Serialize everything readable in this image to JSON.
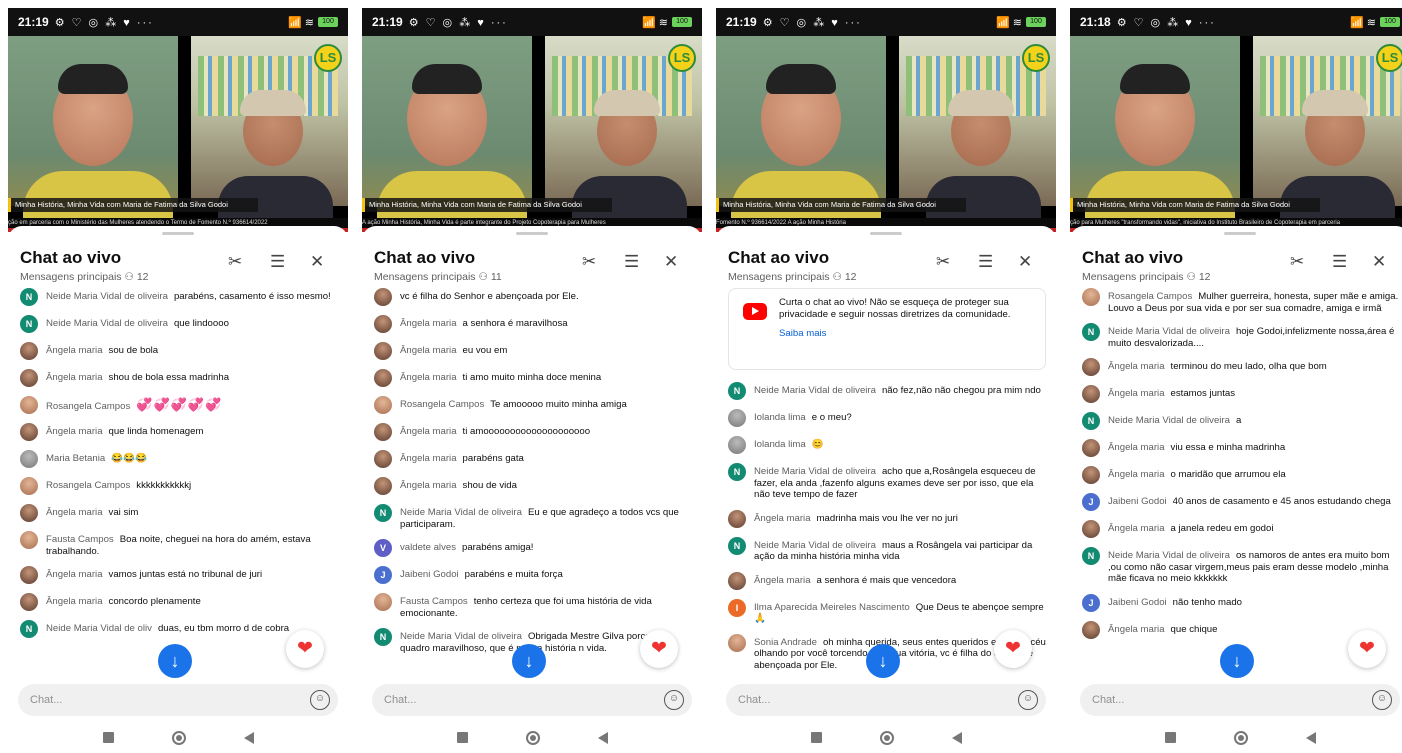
{
  "common": {
    "chat_title": "Chat ao vivo",
    "lower_third": "Minha História, Minha Vida com Maria de Fatima da Silva Godoi",
    "logo_text": "LS",
    "input_placeholder": "Chat...",
    "icons": [
      "scissors-icon",
      "sliders-icon",
      "close-icon",
      "arrow-down-icon",
      "heart-icon",
      "emoji-icon",
      "nav-home-square-icon",
      "nav-circle-icon",
      "nav-back-icon"
    ],
    "colors": {
      "accent": "#1a73e8",
      "heart": "#ee3333",
      "lower_third_bar": "#f2c20f",
      "avatar_n": "#138a72"
    }
  },
  "phones": [
    {
      "time": "21:19",
      "status_icons": "⚙ ♡ ◎ ⁂ ♥ ···",
      "status_right": "📶 ≋",
      "battery": "100",
      "subtitle": "Mensagens principais",
      "viewers": "12",
      "ticker": "ção em parceria com o Ministério das Mulheres atendendo o Termo de Fomento N.º 936614/2022",
      "messages": [
        {
          "av": "n",
          "letter": "N",
          "author": "Neide Maria Vidal de oliveira",
          "text": "parabéns, casamento é isso mesmo!"
        },
        {
          "av": "n",
          "letter": "N",
          "author": "Neide Maria Vidal de oliveira",
          "text": "que lindoooo"
        },
        {
          "av": "p",
          "letter": "",
          "author": "Ângela maria",
          "text": "sou de bola"
        },
        {
          "av": "p",
          "letter": "",
          "author": "Ângela maria",
          "text": "shou de bola essa madrinha"
        },
        {
          "av": "r",
          "letter": "",
          "author": "Rosangela Campos",
          "text": "💞💞💞💞💞"
        },
        {
          "av": "p",
          "letter": "",
          "author": "Ângela maria",
          "text": "que linda homenagem"
        },
        {
          "av": "g",
          "letter": "",
          "author": "Maria Betania",
          "text": "😂😂😂"
        },
        {
          "av": "r",
          "letter": "",
          "author": "Rosangela Campos",
          "text": "kkkkkkkkkkkj"
        },
        {
          "av": "p",
          "letter": "",
          "author": "Ângela maria",
          "text": "vai sim"
        },
        {
          "av": "r",
          "letter": "",
          "author": "Fausta Campos",
          "text": "Boa noite, cheguei na hora do amém, estava trabalhando."
        },
        {
          "av": "p",
          "letter": "",
          "author": "Ângela maria",
          "text": "vamos juntas está no tribunal de juri"
        },
        {
          "av": "p",
          "letter": "",
          "author": "Ângela maria",
          "text": "concordo plenamente"
        },
        {
          "av": "n",
          "letter": "N",
          "author": "Neide Maria Vidal de oliv",
          "text": "duas, eu tbm morro d de cobra"
        }
      ]
    },
    {
      "time": "21:19",
      "status_icons": "⚙ ♡ ◎ ⁂ ♥ ···",
      "status_right": "📶 ≋",
      "battery": "100",
      "subtitle": "Mensagens principais",
      "viewers": "11",
      "ticker": "A ação Minha História, Minha Vida é parte integrante do Projeto Copoterapia para Mulheres",
      "messages": [
        {
          "av": "p",
          "letter": "",
          "author": "",
          "text": "vc é filha do Senhor e abençoada por Ele."
        },
        {
          "av": "p",
          "letter": "",
          "author": "Ângela maria",
          "text": "a senhora é maravilhosa"
        },
        {
          "av": "p",
          "letter": "",
          "author": "Ângela maria",
          "text": "eu vou em"
        },
        {
          "av": "p",
          "letter": "",
          "author": "Ângela maria",
          "text": "ti amo muito minha doce menina"
        },
        {
          "av": "r",
          "letter": "",
          "author": "Rosangela Campos",
          "text": "Te amooooo muito minha amiga"
        },
        {
          "av": "p",
          "letter": "",
          "author": "Ângela maria",
          "text": "ti amoooooooooooooooooooo"
        },
        {
          "av": "p",
          "letter": "",
          "author": "Ângela maria",
          "text": "parabéns gata"
        },
        {
          "av": "p",
          "letter": "",
          "author": "Ângela maria",
          "text": "shou de vida"
        },
        {
          "av": "n",
          "letter": "N",
          "author": "Neide Maria Vidal de oliveira",
          "text": "Eu e que agradeço a todos vcs que participaram."
        },
        {
          "av": "v",
          "letter": "V",
          "author": "valdete alves",
          "text": "parabéns amiga!"
        },
        {
          "av": "j",
          "letter": "J",
          "author": "Jaibeni Godoi",
          "text": "parabéns e muita força"
        },
        {
          "av": "r",
          "letter": "",
          "author": "Fausta Campos",
          "text": "tenho certeza que foi uma história de vida emocionante."
        },
        {
          "av": "n",
          "letter": "N",
          "author": "Neide Maria Vidal de oliveira",
          "text": "Obrigada Mestre Gilva porcesse quadro maravilhoso, que é minha história n vida."
        }
      ]
    },
    {
      "time": "21:19",
      "status_icons": "⚙ ♡ ◎ ⁂ ♥ ···",
      "status_right": "📶 ≋",
      "battery": "100",
      "subtitle": "Mensagens principais",
      "viewers": "12",
      "ticker": "Fomento N.º 936614/2022                    A ação Minha História",
      "promo_text": "Curta o chat ao vivo! Não se esqueça de proteger sua privacidade e seguir nossas diretrizes da comunidade.",
      "promo_link": "Saiba mais",
      "messages": [
        {
          "av": "n",
          "letter": "N",
          "author": "Neide Maria Vidal de oliveira",
          "text": "não fez,não não chegou pra mim ndo"
        },
        {
          "av": "g",
          "letter": "",
          "author": "Iolanda lima",
          "text": "e o meu?"
        },
        {
          "av": "g",
          "letter": "",
          "author": "Iolanda lima",
          "text": "😊"
        },
        {
          "av": "n",
          "letter": "N",
          "author": "Neide Maria Vidal de oliveira",
          "text": "acho que a,Rosângela esqueceu de fazer, ela anda ,fazenfo alguns exames deve ser por isso, que ela não teve tempo de fazer"
        },
        {
          "av": "p",
          "letter": "",
          "author": "Ângela maria",
          "text": "madrinha mais vou lhe ver no juri"
        },
        {
          "av": "n",
          "letter": "N",
          "author": "Neide Maria Vidal de oliveira",
          "text": "maus a Rosângela vai participar da ação da minha história minha vida"
        },
        {
          "av": "p",
          "letter": "",
          "author": "Ângela maria",
          "text": "a senhora é mais que vencedora"
        },
        {
          "av": "i",
          "letter": "I",
          "author": "Ilma Aparecida Meireles Nascimento",
          "text": "Que Deus te abençoe sempre 🙏"
        },
        {
          "av": "r",
          "letter": "",
          "author": "Sonia Andrade",
          "text": "oh minha querida, seus entes queridos estão no céu olhando por você torcendo pela sua vitória, vc é filha do Senhor e abençoada por Ele."
        }
      ]
    },
    {
      "time": "21:18",
      "status_icons": "⚙ ♡ ◎ ⁂ ♥ ···",
      "status_right": "📶 ≋",
      "battery": "100",
      "subtitle": "Mensagens principais",
      "viewers": "12",
      "ticker": "ção para Mulheres \"transformando vidas\", iniciativa do Instituto Brasileiro de Copoterapia em parceria",
      "messages": [
        {
          "av": "r",
          "letter": "",
          "author": "Rosangela Campos",
          "text": "Mulher guerreira, honesta, super mãe e amiga. Louvo a Deus por sua vida e por ser sua comadre, amiga e irmã"
        },
        {
          "av": "n",
          "letter": "N",
          "author": "Neide Maria Vidal de oliveira",
          "text": "hoje Godoi,infelizmente nossa,área é muito desvalorizada...."
        },
        {
          "av": "p",
          "letter": "",
          "author": "Ângela maria",
          "text": "terminou do meu lado, olha que bom"
        },
        {
          "av": "p",
          "letter": "",
          "author": "Ângela maria",
          "text": "estamos juntas"
        },
        {
          "av": "n",
          "letter": "N",
          "author": "Neide Maria Vidal de oliveira",
          "text": "a"
        },
        {
          "av": "p",
          "letter": "",
          "author": "Ângela maria",
          "text": "viu essa e minha madrinha"
        },
        {
          "av": "p",
          "letter": "",
          "author": "Ângela maria",
          "text": "o maridão que arrumou ela"
        },
        {
          "av": "j",
          "letter": "J",
          "author": "Jaibeni Godoi",
          "text": "40 anos de casamento e 45 anos estudando chega"
        },
        {
          "av": "p",
          "letter": "",
          "author": "Ângela maria",
          "text": "a janela redeu em godoi"
        },
        {
          "av": "n",
          "letter": "N",
          "author": "Neide Maria Vidal de oliveira",
          "text": "os namoros de antes era muito bom ,ou como não casar virgem,meus pais eram desse modelo ,minha mãe ficava no meio kkkkkkk"
        },
        {
          "av": "j",
          "letter": "J",
          "author": "Jaibeni Godoi",
          "text": "não tenho mado"
        },
        {
          "av": "p",
          "letter": "",
          "author": "Ângela maria",
          "text": "que chique"
        }
      ]
    }
  ]
}
